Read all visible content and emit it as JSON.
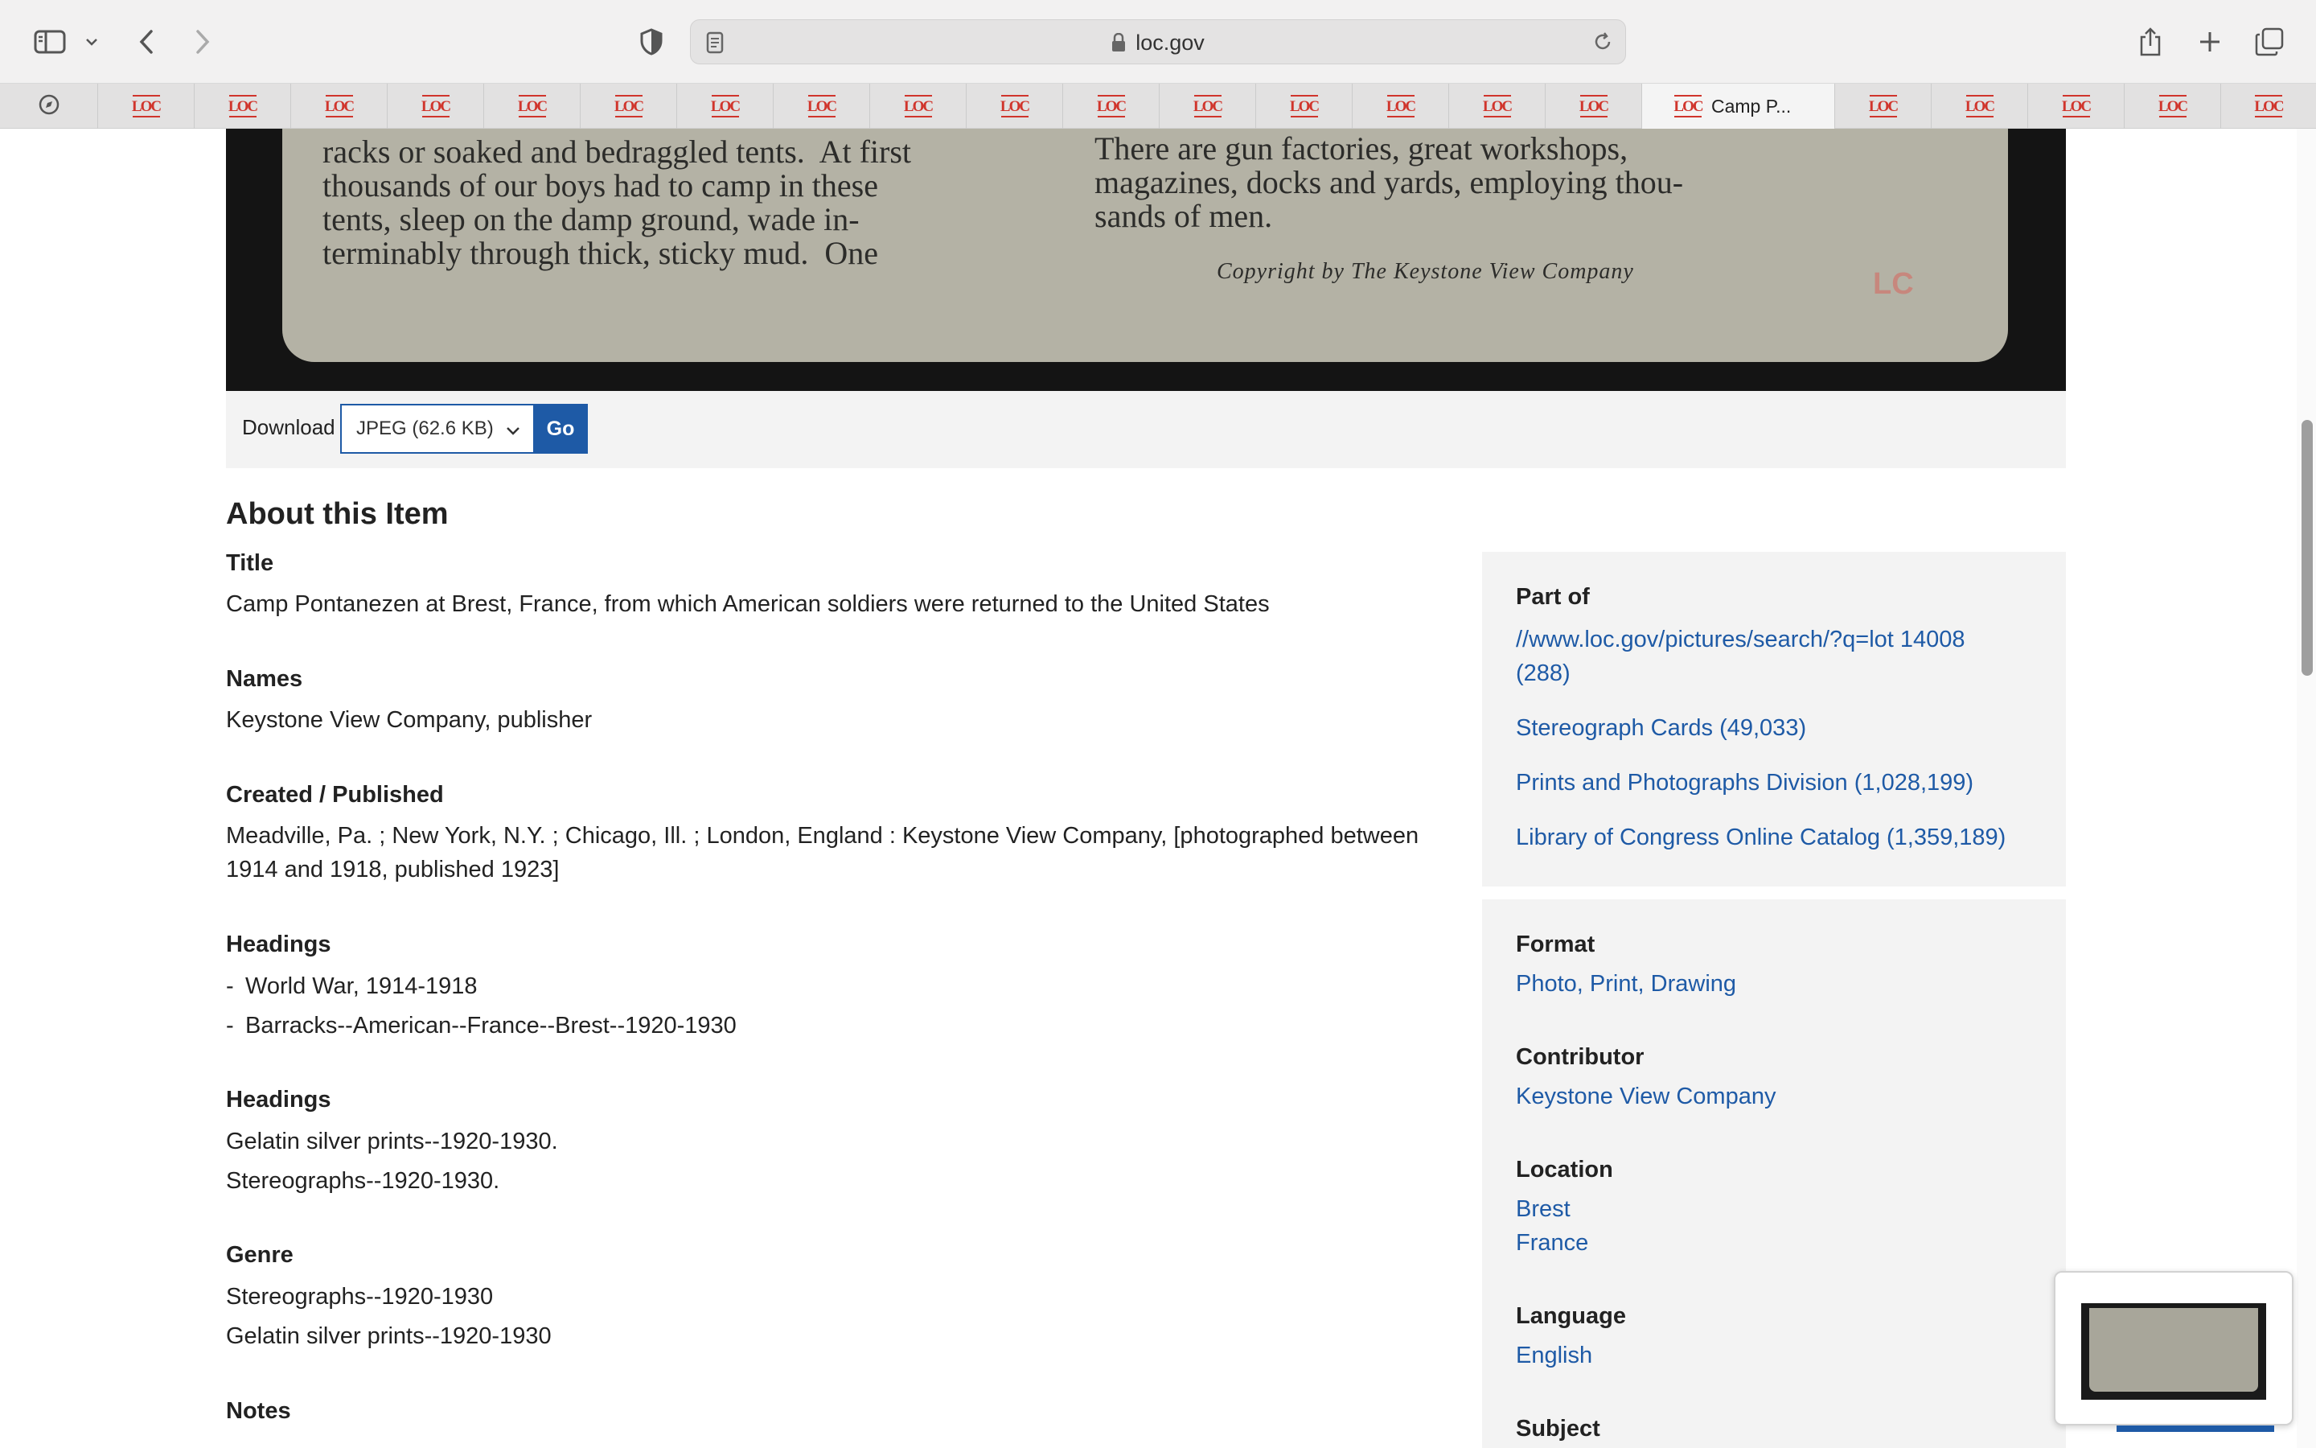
{
  "browser": {
    "address": "loc.gov",
    "active_tab_title": "Camp P...",
    "favicon_text": "LOC"
  },
  "hero": {
    "left_column": "racks or soaked and bedraggled tents.  At first\nthousands of our boys had to camp in these\ntents, sleep on the damp ground, wade in-\nterminably through thick, sticky mud.  One",
    "right_column": "There are gun factories, great workshops,\nmagazines, docks and yards, employing thou-\nsands of men.",
    "copyright": "Copyright by The Keystone View Company",
    "mark": "LC"
  },
  "download": {
    "label": "Download",
    "selected": "JPEG (62.6 KB)",
    "go": "Go"
  },
  "about": {
    "heading": "About this Item",
    "title_label": "Title",
    "title_value": "Camp Pontanezen at Brest, France, from which American soldiers were returned to the United States",
    "names_label": "Names",
    "names_value": "Keystone View Company, publisher",
    "created_label": "Created / Published",
    "created_value": "Meadville, Pa. ; New York, N.Y. ; Chicago, Ill. ; London, England : Keystone View Company, [photographed between 1914 and 1918, published 1923]",
    "headings1_label": "Headings",
    "headings1_items": [
      "World War, 1914-1918",
      "Barracks--American--France--Brest--1920-1930"
    ],
    "headings2_label": "Headings",
    "headings2_items": [
      "Gelatin silver prints--1920-1930.",
      "Stereographs--1920-1930."
    ],
    "genre_label": "Genre",
    "genre_items": [
      "Stereographs--1920-1930",
      "Gelatin silver prints--1920-1930"
    ],
    "notes_label": "Notes",
    "dash": "-"
  },
  "sidebar": {
    "part_of_label": "Part of",
    "part_of_links": [
      "//www.loc.gov/pictures/search/?q=lot 14008 (288)",
      "Stereograph Cards (49,033)",
      "Prints and Photographs Division (1,028,199)",
      "Library of Congress Online Catalog (1,359,189)"
    ],
    "format_label": "Format",
    "format_value": "Photo, Print, Drawing",
    "contributor_label": "Contributor",
    "contributor_value": "Keystone View Company",
    "location_label": "Location",
    "location_values": [
      "Brest",
      "France"
    ],
    "language_label": "Language",
    "language_value": "English",
    "subject_label": "Subject"
  }
}
